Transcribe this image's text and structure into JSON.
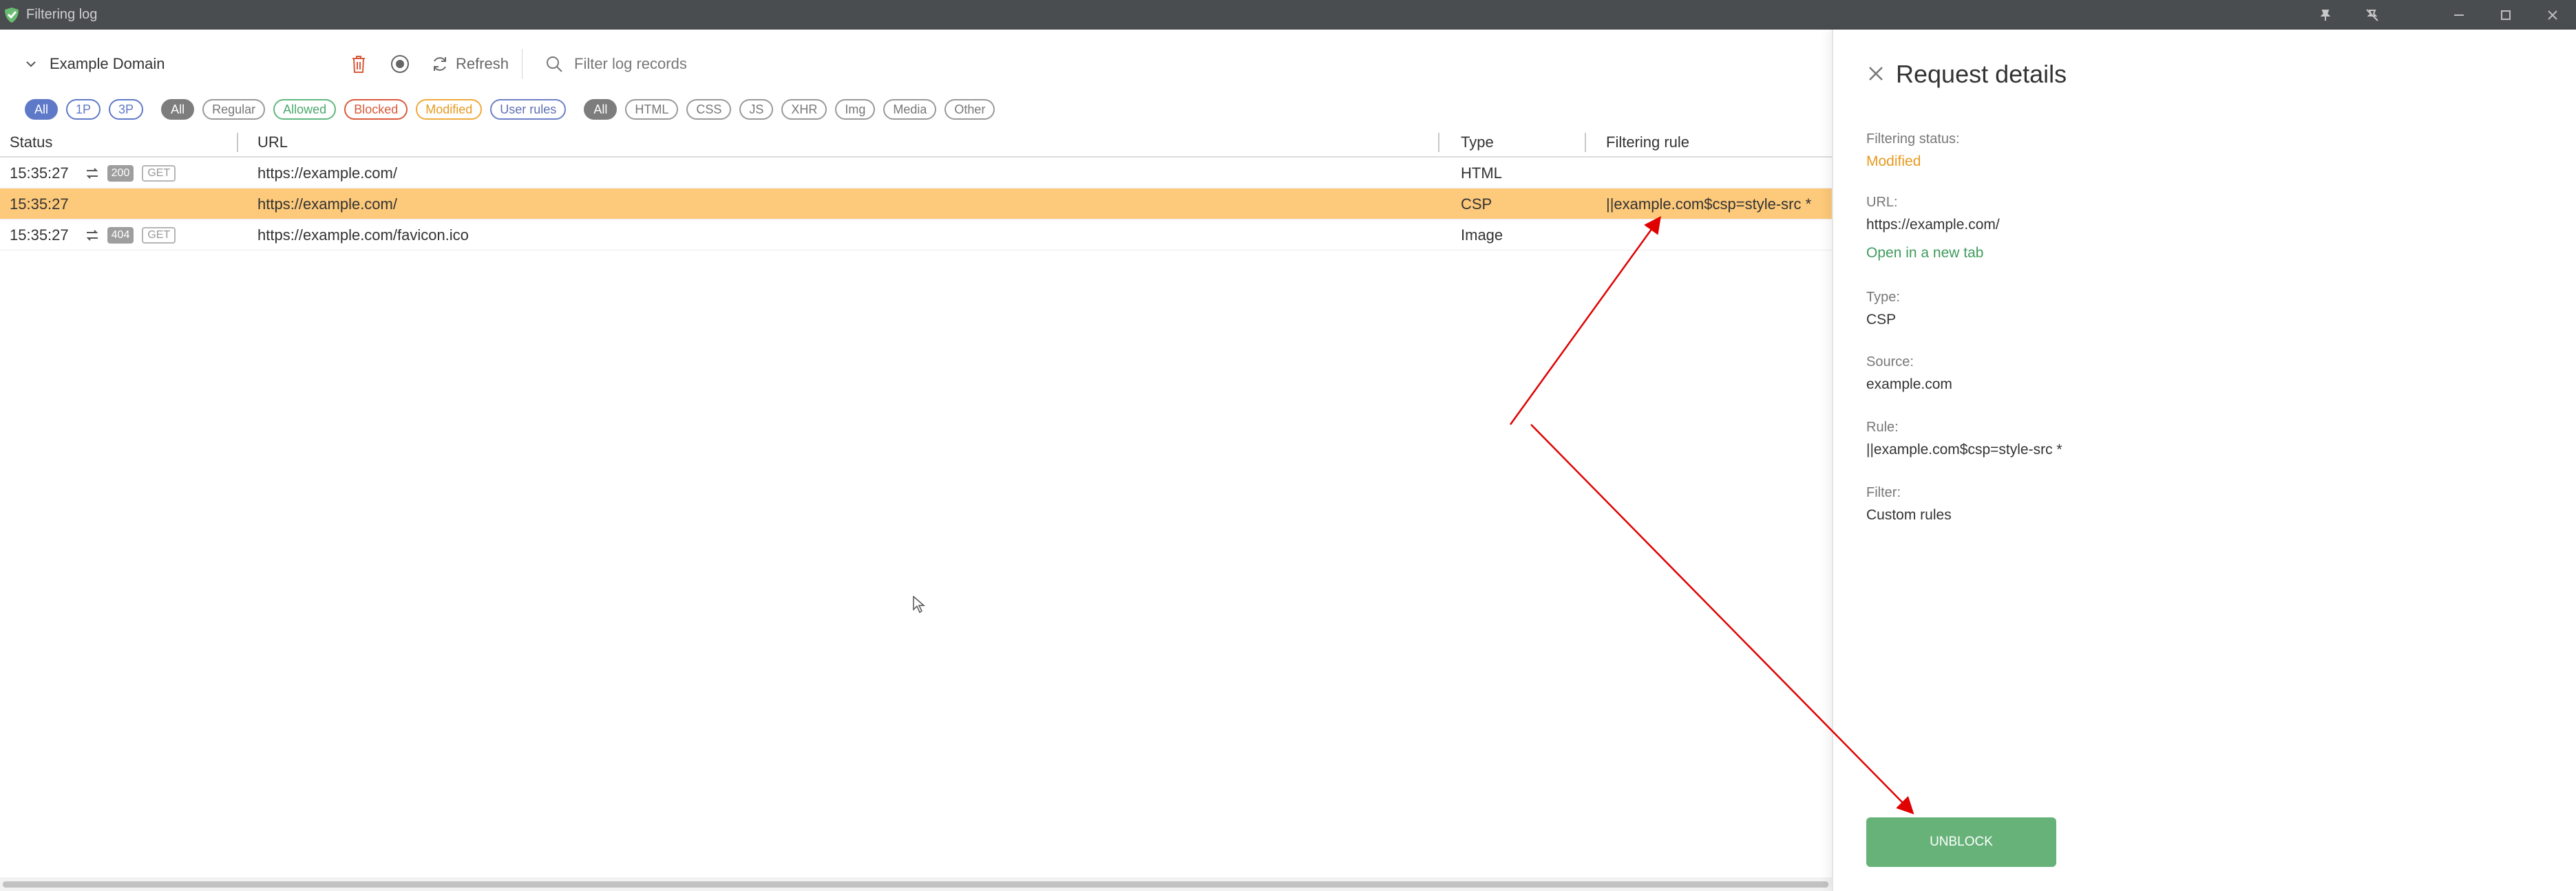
{
  "window": {
    "title": "Filtering log"
  },
  "toolbar": {
    "site": "Example Domain",
    "refresh_label": "Refresh",
    "search_placeholder": "Filter log records"
  },
  "filters": {
    "party": [
      "All",
      "1P",
      "3P"
    ],
    "status": [
      "All",
      "Regular",
      "Allowed",
      "Blocked",
      "Modified",
      "User rules"
    ],
    "content": [
      "All",
      "HTML",
      "CSS",
      "JS",
      "XHR",
      "Img",
      "Media",
      "Other"
    ]
  },
  "table": {
    "headers": [
      "Status",
      "URL",
      "Type",
      "Filtering rule"
    ],
    "rows": [
      {
        "time": "15:35:27",
        "code": "200",
        "method": "GET",
        "url": "https://example.com/",
        "type": "HTML",
        "rule": ""
      },
      {
        "time": "15:35:27",
        "code": "",
        "method": "",
        "url": "https://example.com/",
        "type": "CSP",
        "rule": "||example.com$csp=style-src *"
      },
      {
        "time": "15:35:27",
        "code": "404",
        "method": "GET",
        "url": "https://example.com/favicon.ico",
        "type": "Image",
        "rule": ""
      }
    ]
  },
  "details": {
    "title": "Request details",
    "status_label": "Filtering status:",
    "status_value": "Modified",
    "url_label": "URL:",
    "url_value": "https://example.com/",
    "open_link": "Open in a new tab",
    "type_label": "Type:",
    "type_value": "CSP",
    "source_label": "Source:",
    "source_value": "example.com",
    "rule_label": "Rule:",
    "rule_value": "||example.com$csp=style-src *",
    "filter_label": "Filter:",
    "filter_value": "Custom rules",
    "unblock_label": "UNBLOCK"
  },
  "colors": {
    "titlebar": "#4a4d50",
    "selected_row": "#fdc97a",
    "accent_blue": "#5f79c9",
    "modified": "#e79a20",
    "unblock": "#67b279",
    "annotation": "#e00000"
  },
  "icons": [
    "adguard-icon",
    "pin-icon",
    "pin-off-icon",
    "minimize-icon",
    "maximize-icon",
    "close-icon",
    "chevron-down-icon",
    "trash-icon",
    "record-icon",
    "refresh-icon",
    "search-icon",
    "transfer-arrows-icon",
    "cursor-icon"
  ]
}
